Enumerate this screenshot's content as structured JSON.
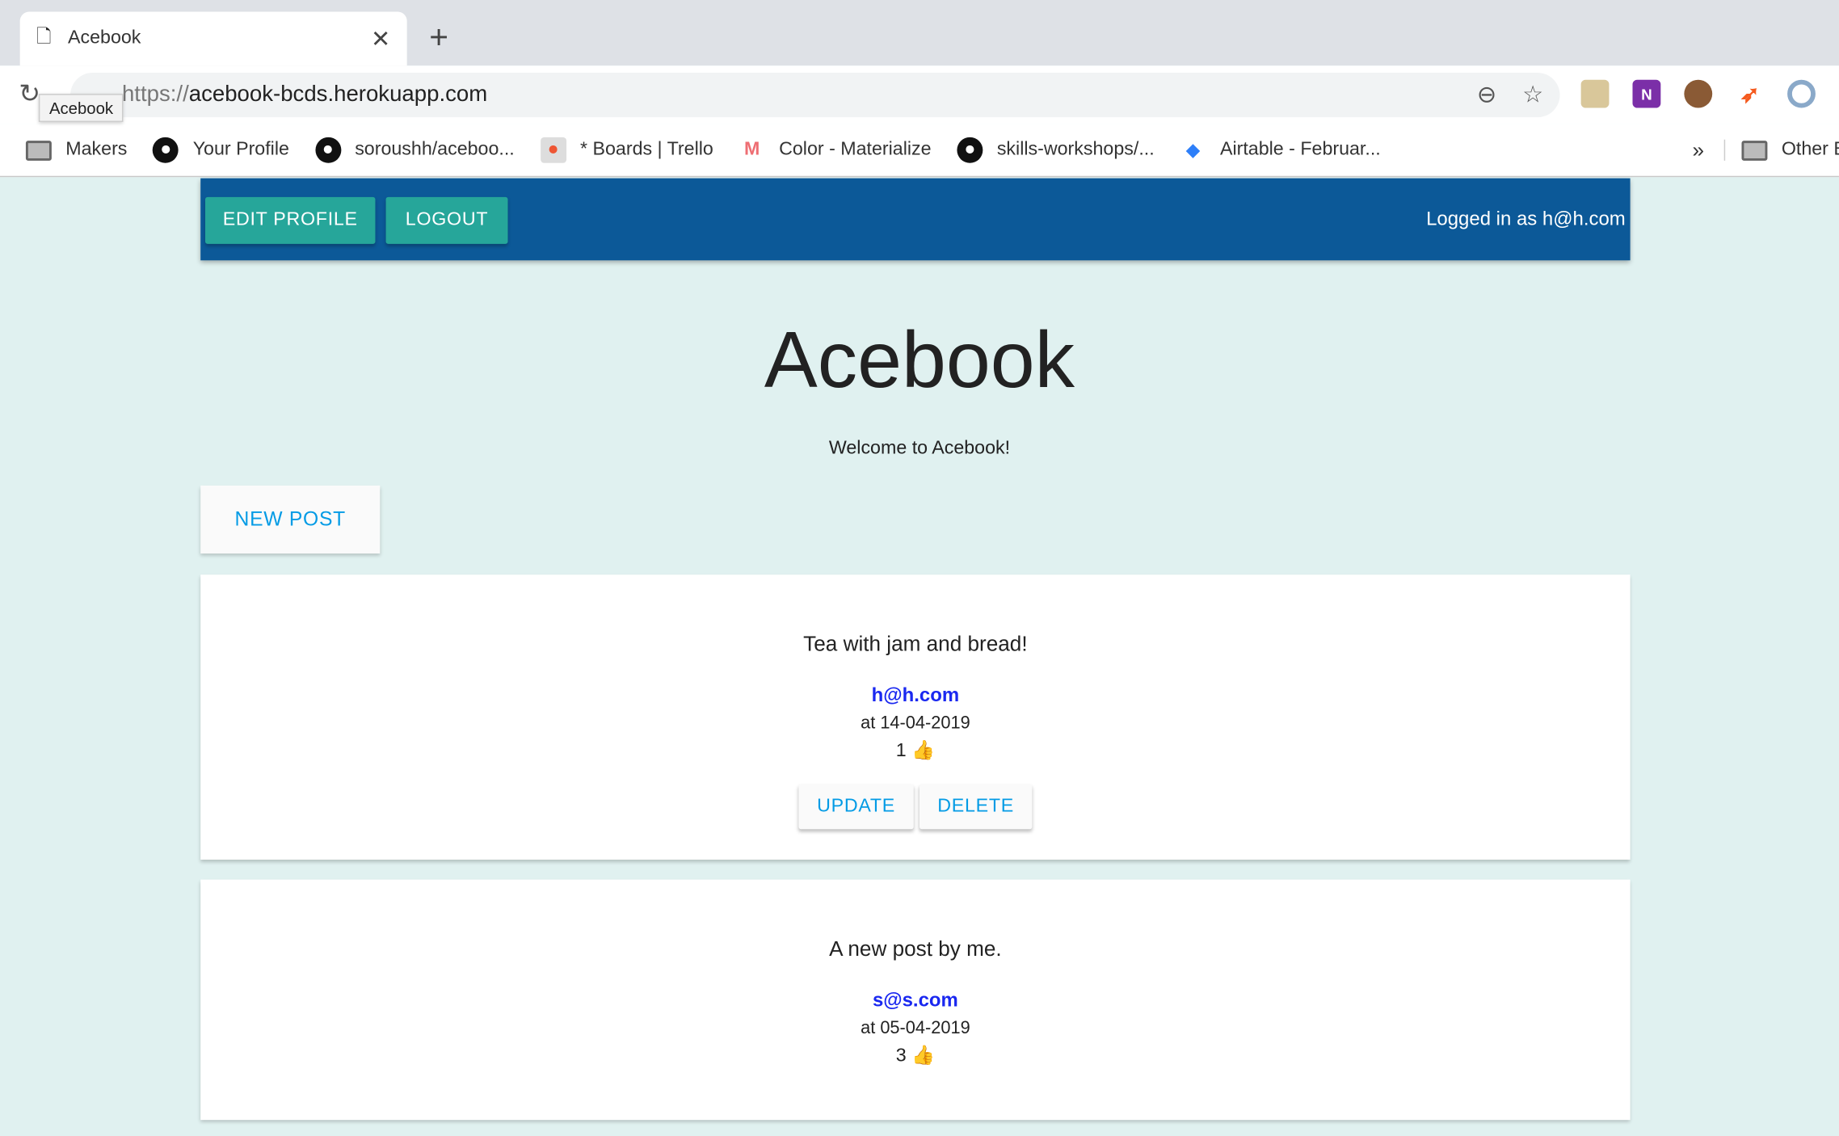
{
  "browser": {
    "tab_title": "Acebook",
    "url_scheme": "https://",
    "url_host": "acebook-bcds.herokuapp.com",
    "tooltip": "Acebook",
    "bookmarks": [
      {
        "label": "Makers",
        "icon": "folder-icon"
      },
      {
        "label": "Your Profile",
        "icon": "github-icon"
      },
      {
        "label": "soroushh/aceboo...",
        "icon": "github-icon"
      },
      {
        "label": "* Boards | Trello",
        "icon": "trello-icon"
      },
      {
        "label": "Color - Materialize",
        "icon": "materialize-icon"
      },
      {
        "label": "skills-workshops/...",
        "icon": "github-icon"
      },
      {
        "label": "Airtable - Februar...",
        "icon": "airtable-icon"
      }
    ],
    "overflow": "»",
    "other_bookmarks": "Other Bookmarks"
  },
  "navbar": {
    "edit_profile": "EDIT PROFILE",
    "logout": "LOGOUT",
    "logged_in": "Logged in as h@h.com"
  },
  "page": {
    "title": "Acebook",
    "welcome": "Welcome to Acebook!",
    "new_post": "NEW POST"
  },
  "posts": [
    {
      "message": "Tea with jam and bread!",
      "author": "h@h.com",
      "date": "at 14-04-2019",
      "likes": "1 👍",
      "update": "UPDATE",
      "delete": "DELETE"
    },
    {
      "message": "A new post by me.",
      "author": "s@s.com",
      "date": "at 05-04-2019",
      "likes": "3 👍"
    }
  ],
  "colors": {
    "navbar": "#0c5998",
    "teal": "#26a69a",
    "link": "#1a28f0",
    "accent": "#039be5",
    "background": "#e0f1f0"
  }
}
